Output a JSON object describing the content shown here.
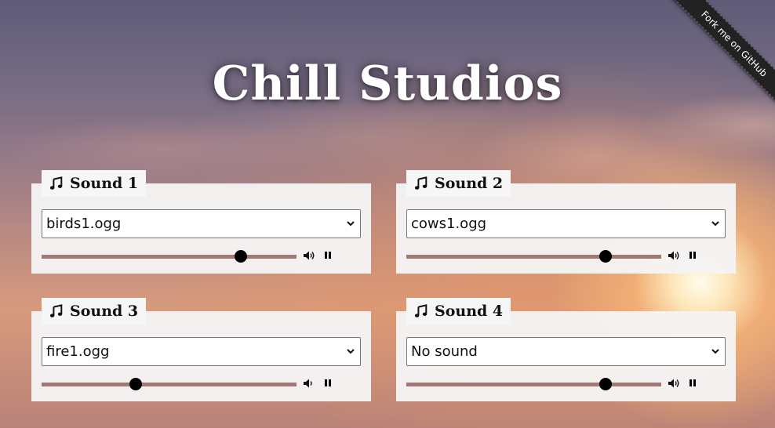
{
  "app": {
    "title": "Chill Studios",
    "ribbon": "Fork me on GitHub"
  },
  "sounds": [
    {
      "label": "Sound 1",
      "selected": "birds1.ogg",
      "volume": 0.78,
      "volume_icon": "volume-high-icon",
      "control_icon": "pause-icon"
    },
    {
      "label": "Sound 2",
      "selected": "cows1.ogg",
      "volume": 0.78,
      "volume_icon": "volume-high-icon",
      "control_icon": "pause-icon"
    },
    {
      "label": "Sound 3",
      "selected": "fire1.ogg",
      "volume": 0.37,
      "volume_icon": "volume-low-icon",
      "control_icon": "pause-icon"
    },
    {
      "label": "Sound 4",
      "selected": "No sound",
      "volume": 0.78,
      "volume_icon": "volume-high-icon",
      "control_icon": "pause-icon"
    }
  ],
  "colors": {
    "slider_track": "#a07874",
    "slider_thumb": "#000000",
    "card_bg": "#f5f4f4"
  }
}
